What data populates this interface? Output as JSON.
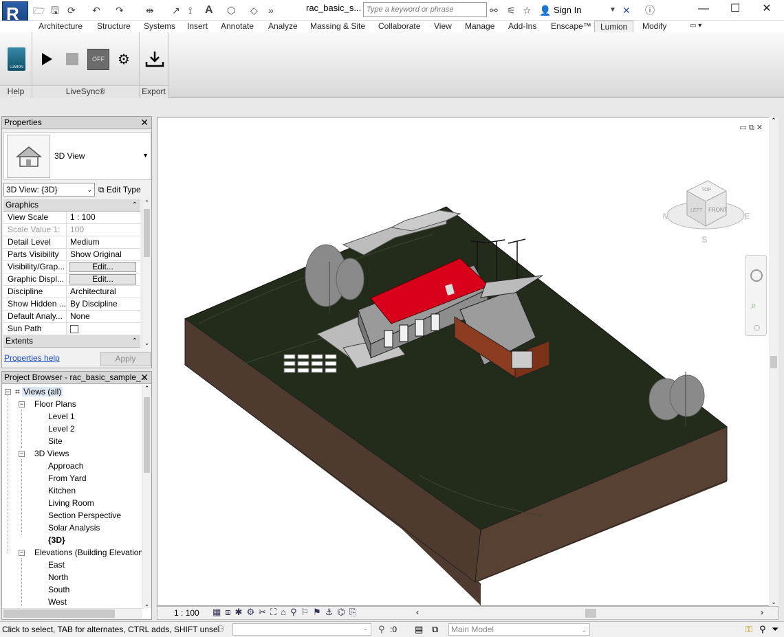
{
  "app": {
    "logo_letter": "R",
    "document_title": "rac_basic_s...",
    "search_placeholder": "Type a keyword or phrase",
    "sign_in": "Sign In",
    "window_controls": {
      "minimize": "—",
      "maximize": "☐",
      "close": "✕"
    }
  },
  "ribbon": {
    "tabs": [
      "Architecture",
      "Structure",
      "Systems",
      "Insert",
      "Annotate",
      "Analyze",
      "Massing & Site",
      "Collaborate",
      "View",
      "Manage",
      "Add-Ins",
      "Enscape™",
      "Lumion",
      "Modify"
    ],
    "active_tab": "Lumion",
    "panels": {
      "help": "Help",
      "livesync": "LiveSync®",
      "export": "Export"
    },
    "logo_text": "LUMION",
    "toggle_label": "OFF"
  },
  "properties": {
    "title": "Properties",
    "type_name": "3D View",
    "view_selector": "3D View: {3D}",
    "edit_type": "Edit Type",
    "groups": {
      "graphics": "Graphics",
      "extents": "Extents"
    },
    "rows": [
      {
        "key": "View Scale",
        "value": "1 : 100"
      },
      {
        "key": "Scale Value    1:",
        "value": "100"
      },
      {
        "key": "Detail Level",
        "value": "Medium"
      },
      {
        "key": "Parts Visibility",
        "value": "Show Original"
      },
      {
        "key": "Visibility/Grap...",
        "value": "Edit..."
      },
      {
        "key": "Graphic Displ...",
        "value": "Edit..."
      },
      {
        "key": "Discipline",
        "value": "Architectural"
      },
      {
        "key": "Show Hidden ...",
        "value": "By Discipline"
      },
      {
        "key": "Default Analy...",
        "value": "None"
      },
      {
        "key": "Sun Path",
        "value": ""
      }
    ],
    "help_link": "Properties help",
    "apply": "Apply"
  },
  "project_browser": {
    "title": "Project Browser - rac_basic_sample_...",
    "root": "Views (all)",
    "floor_plans": {
      "label": "Floor Plans",
      "items": [
        "Level 1",
        "Level 2",
        "Site"
      ]
    },
    "views_3d": {
      "label": "3D Views",
      "items": [
        "Approach",
        "From Yard",
        "Kitchen",
        "Living Room",
        "Section Perspective",
        "Solar Analysis",
        "{3D}"
      ]
    },
    "elevations": {
      "label": "Elevations (Building Elevation",
      "items": [
        "East",
        "North",
        "South",
        "West"
      ]
    }
  },
  "viewcube": {
    "top": "TOP",
    "left": "LEFT",
    "front": "FRONT",
    "w": "W",
    "e": "E",
    "s": "S"
  },
  "view_control_bar": {
    "scale": "1 : 100"
  },
  "status": {
    "message": "Click to select, TAB for alternates, CTRL adds, SHIFT unsel",
    "selection_count": ":0",
    "model": "Main Model"
  },
  "colors": {
    "roof": "#d9001b",
    "ground": "#232c1a",
    "soil": "#4e3a2e",
    "accent": "#2b5da8"
  }
}
